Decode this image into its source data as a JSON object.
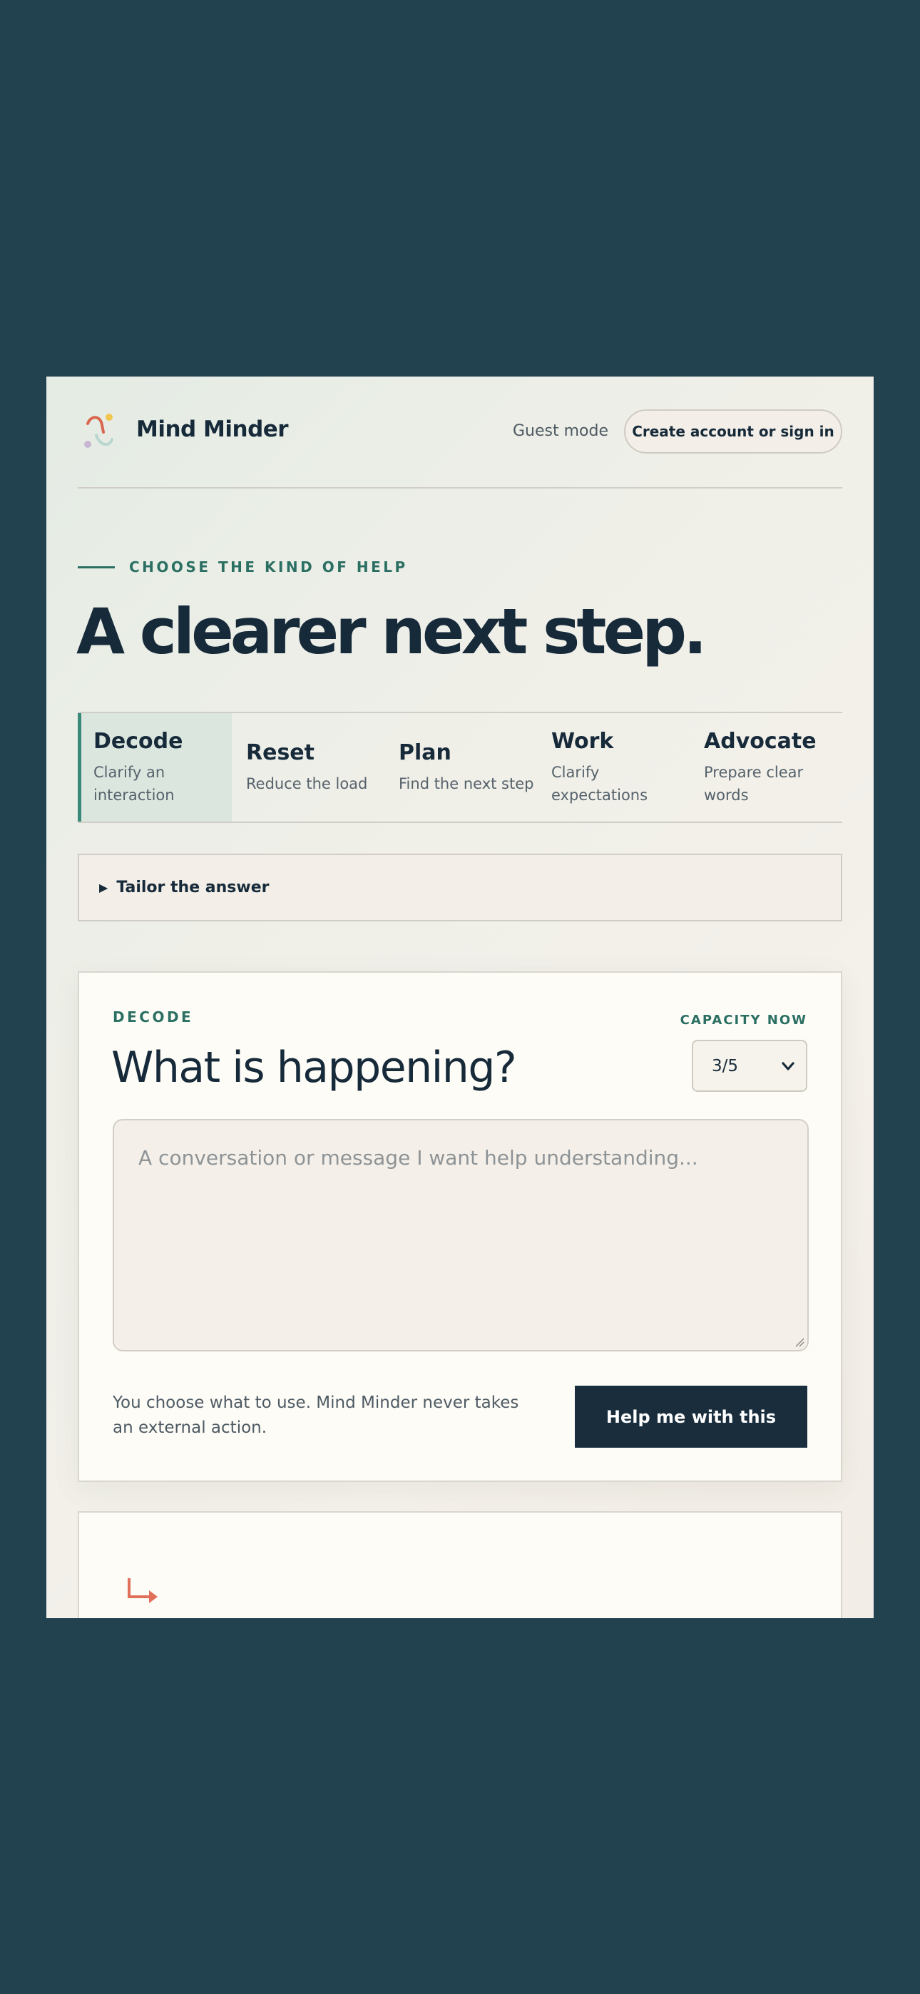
{
  "header": {
    "brand": "Mind Minder",
    "logo_icon": "mind-minder-logo-icon",
    "guest_mode": "Guest mode",
    "signin_label": "Create account or sign in"
  },
  "hero": {
    "eyebrow": "CHOOSE THE KIND OF HELP",
    "title": "A clearer next step."
  },
  "tabs": [
    {
      "title": "Decode",
      "subtitle": "Clarify an interaction",
      "active": true
    },
    {
      "title": "Reset",
      "subtitle": "Reduce the load",
      "active": false
    },
    {
      "title": "Plan",
      "subtitle": "Find the next step",
      "active": false
    },
    {
      "title": "Work",
      "subtitle": "Clarify expectations",
      "active": false
    },
    {
      "title": "Advocate",
      "subtitle": "Prepare clear words",
      "active": false
    }
  ],
  "tailor": {
    "label": "Tailor the answer",
    "icon": "disclosure-triangle-icon"
  },
  "card": {
    "eyebrow": "DECODE",
    "title": "What is happening?",
    "capacity_label": "CAPACITY NOW",
    "capacity_value": "3/5",
    "textarea_placeholder": "A conversation or message I want help understanding...",
    "note": "You choose what to use. Mind Minder never takes an external action.",
    "submit_label": "Help me with this"
  },
  "card2": {
    "icon": "return-arrow-icon"
  },
  "colors": {
    "accent_teal": "#2b6f63",
    "dark_navy": "#192d3d",
    "background": "#234250",
    "arrow_coral": "#e0705a"
  }
}
